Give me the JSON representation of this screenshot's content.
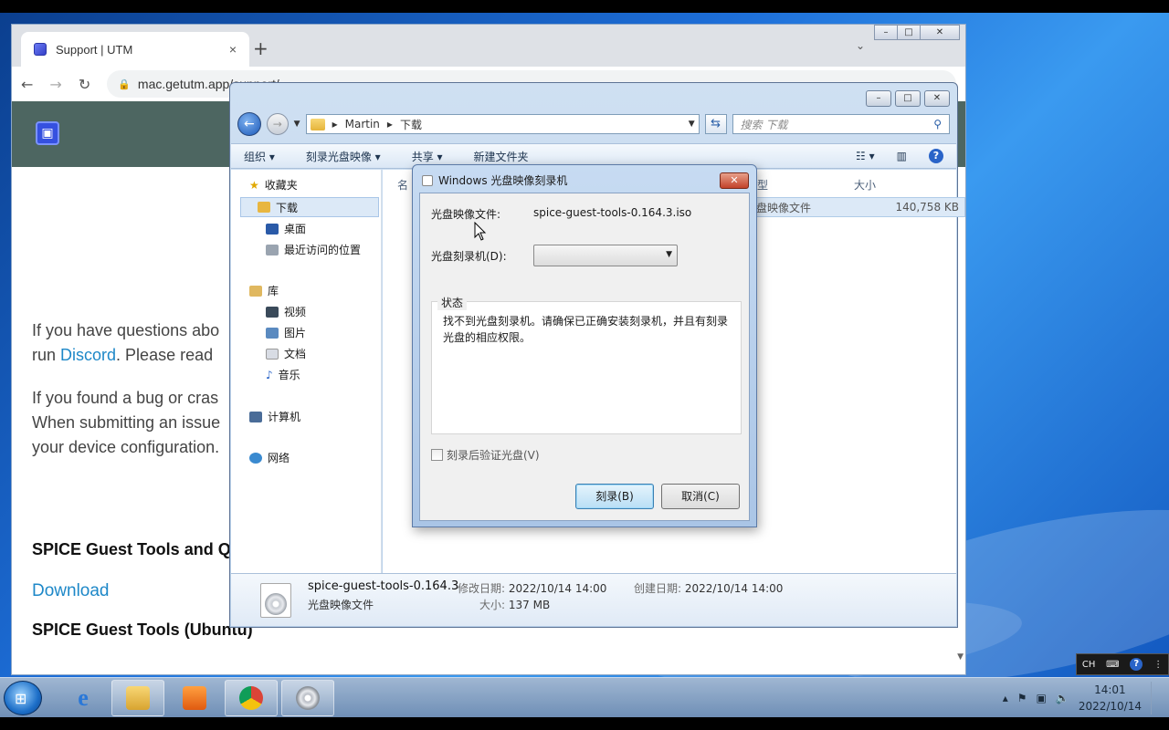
{
  "browser": {
    "tab_title": "Support | UTM",
    "tab_close": "×",
    "new_tab": "+",
    "url": "mac.getutm.app/support/",
    "window_controls": [
      "–",
      "□",
      "✕"
    ]
  },
  "webpage": {
    "para1_line1": "If you have questions abo",
    "para1_line2_pre": "run ",
    "para1_link": "Discord",
    "para1_line2_post": ". Please read",
    "para2_line1": "If you found a bug or cras",
    "para2_line2": "When submitting an issue",
    "para2_line3": "your device configuration.",
    "heading1": "SPICE Guest Tools and Q",
    "download_link": "Download",
    "heading2": "SPICE Guest Tools (Ubuntu)"
  },
  "explorer": {
    "breadcrumb": [
      "Martin",
      "下载"
    ],
    "search_placeholder": "搜索 下载",
    "toolbar": [
      "组织 ▾",
      "刻录光盘映像 ▾",
      "共享 ▾",
      "新建文件夹"
    ],
    "nav": {
      "favorites": "收藏夹",
      "downloads": "下载",
      "desktop": "桌面",
      "recent": "最近访问的位置",
      "libraries": "库",
      "videos": "视频",
      "pictures": "图片",
      "documents": "文档",
      "music": "音乐",
      "computer": "计算机",
      "network": "网络"
    },
    "columns": {
      "name": "名",
      "type": "型",
      "size": "大小"
    },
    "file_row": {
      "type": "盘映像文件",
      "size": "140,758 KB"
    },
    "details": {
      "filename": "spice-guest-tools-0.164.3",
      "filetype": "光盘映像文件",
      "modified_label": "修改日期:",
      "modified": "2022/10/14 14:00",
      "created_label": "创建日期:",
      "created": "2022/10/14 14:00",
      "size_label": "大小:",
      "size": "137 MB"
    }
  },
  "dialog": {
    "title": "Windows 光盘映像刻录机",
    "close": "✕",
    "image_label": "光盘映像文件:",
    "image_value": "spice-guest-tools-0.164.3.iso",
    "burner_label": "光盘刻录机(D):",
    "burner_value": "",
    "status_legend": "状态",
    "status_msg": "找不到光盘刻录机。请确保已正确安装刻录机，并且有刻录光盘的相应权限。",
    "verify_label": "刻录后验证光盘(V)",
    "verify_checked": false,
    "burn_button": "刻录(B)",
    "cancel_button": "取消(C)"
  },
  "taskbar": {
    "time": "14:01",
    "date": "2022/10/14",
    "lang": "CH"
  }
}
